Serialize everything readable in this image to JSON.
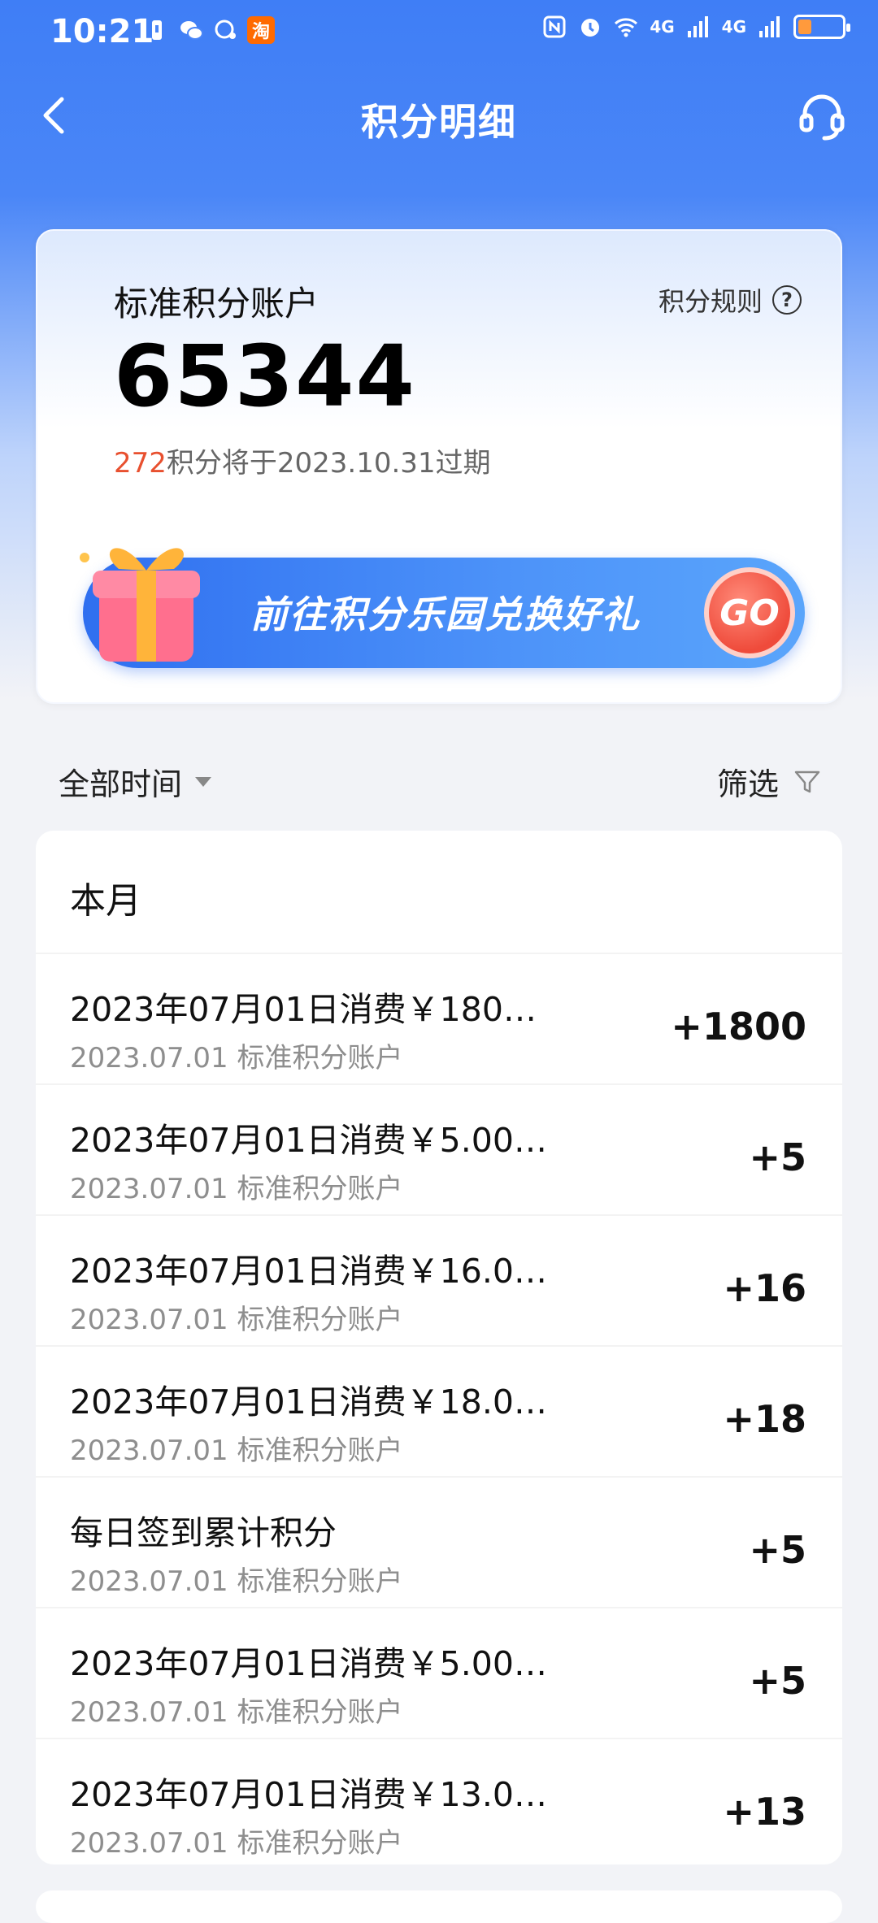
{
  "status_bar": {
    "time": "10:21",
    "taobao_label": "淘",
    "net1": "4G",
    "net2": "4G"
  },
  "navbar": {
    "title": "积分明细",
    "back_icon": "chevron-left-icon",
    "service_icon": "headset-icon"
  },
  "account": {
    "label": "标准积分账户",
    "rules_label": "积分规则",
    "points": "65344",
    "expire_amount": "272",
    "expire_text": "积分将于2023.10.31过期"
  },
  "banner": {
    "text": "前往积分乐园兑换好礼",
    "go_label": "GO",
    "accent": "#3b7df3",
    "go_color": "#ef4b3b"
  },
  "filters": {
    "time_label": "全部时间",
    "filter_label": "筛选"
  },
  "list": {
    "month_label": "本月",
    "items": [
      {
        "title": "2023年07月01日消费￥180…",
        "sub": "2023.07.01 标准积分账户",
        "amount": "+1800"
      },
      {
        "title": "2023年07月01日消费￥5.00…",
        "sub": "2023.07.01 标准积分账户",
        "amount": "+5"
      },
      {
        "title": "2023年07月01日消费￥16.0…",
        "sub": "2023.07.01 标准积分账户",
        "amount": "+16"
      },
      {
        "title": "2023年07月01日消费￥18.0…",
        "sub": "2023.07.01 标准积分账户",
        "amount": "+18"
      },
      {
        "title": "每日签到累计积分",
        "sub": "2023.07.01 标准积分账户",
        "amount": "+5"
      },
      {
        "title": "2023年07月01日消费￥5.00…",
        "sub": "2023.07.01 标准积分账户",
        "amount": "+5"
      },
      {
        "title": "2023年07月01日消费￥13.0…",
        "sub": "2023.07.01 标准积分账户",
        "amount": "+13"
      }
    ]
  }
}
